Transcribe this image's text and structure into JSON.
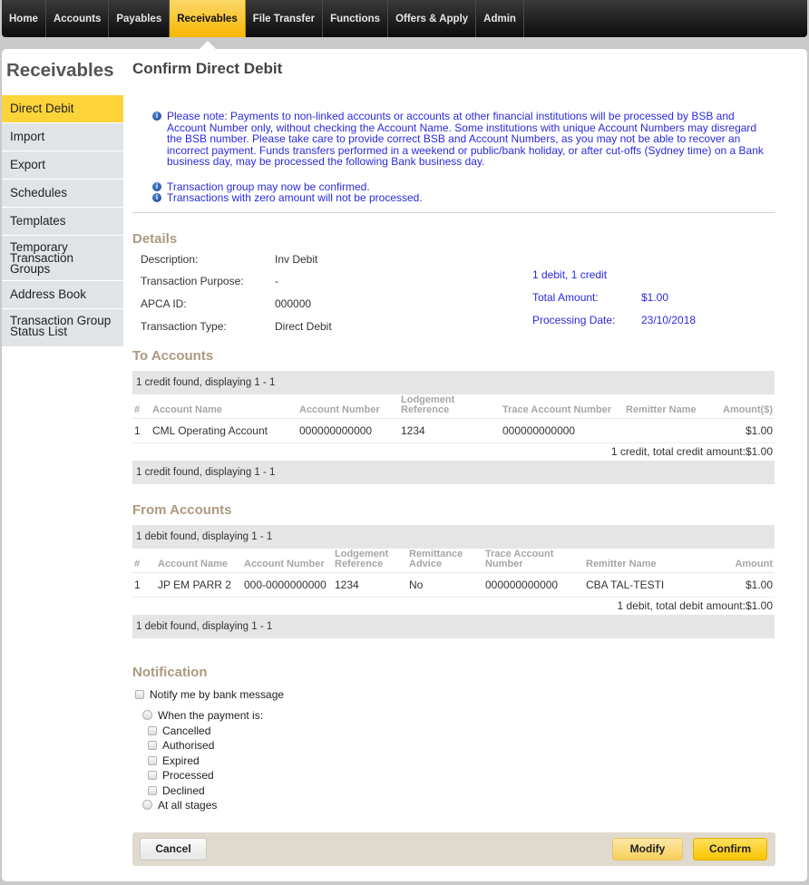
{
  "topnav": {
    "tabs": [
      {
        "label": "Home"
      },
      {
        "label": "Accounts"
      },
      {
        "label": "Payables"
      },
      {
        "label": "Receivables",
        "active": true
      },
      {
        "label": "File Transfer"
      },
      {
        "label": "Functions"
      },
      {
        "label": "Offers & Apply"
      },
      {
        "label": "Admin"
      }
    ]
  },
  "sidebar": {
    "title": "Receivables",
    "items": [
      {
        "label": "Direct Debit",
        "active": true
      },
      {
        "label": "Import"
      },
      {
        "label": "Export"
      },
      {
        "label": "Schedules"
      },
      {
        "label": "Templates"
      },
      {
        "label": "Temporary Transaction Groups"
      },
      {
        "label": "Address Book"
      },
      {
        "label": "Transaction Group Status List"
      }
    ]
  },
  "page": {
    "title": "Confirm Direct Debit",
    "notes": [
      "Please note: Payments to non-linked accounts or accounts at other financial institutions will be processed by BSB and Account Number only, without checking the Account Name. Some institutions with unique Account Numbers may disregard the BSB number. Please take care to provide correct BSB and Account Numbers, as you may not be able to recover an incorrect payment. Funds transfers performed in a weekend or public/bank holiday, or after cut-offs (Sydney time) on a Bank business day, may be processed the following Bank business day.",
      "Transaction group may now be confirmed.",
      "Transactions with zero amount will not be processed."
    ]
  },
  "details": {
    "title": "Details",
    "rows": [
      {
        "label": "Description:",
        "value": "Inv Debit"
      },
      {
        "label": "Transaction Purpose:",
        "value": "-"
      },
      {
        "label": "APCA ID:",
        "value": "000000"
      },
      {
        "label": "Transaction Type:",
        "value": "Direct Debit"
      }
    ],
    "summary": "1 debit, 1 credit",
    "total_amount_label": "Total Amount:",
    "total_amount": "$1.00",
    "processing_date_label": "Processing Date:",
    "processing_date": "23/10/2018"
  },
  "to_accounts": {
    "title": "To Accounts",
    "found_text": "1 credit found, displaying 1 - 1",
    "headers": [
      "#",
      "Account Name",
      "Account Number",
      "Lodgement Reference",
      "Trace Account Number",
      "Remitter Name",
      "Amount($)"
    ],
    "rows": [
      [
        "1",
        "CML Operating Account",
        "000000000000",
        "1234",
        "000000000000",
        "",
        "$1.00"
      ]
    ],
    "total_text": "1 credit, total credit amount:$1.00"
  },
  "from_accounts": {
    "title": "From Accounts",
    "found_text": "1 debit found, displaying 1 - 1",
    "headers": [
      "#",
      "Account Name",
      "Account Number",
      "Lodgement Reference",
      "Remittance Advice",
      "Trace Account Number",
      "Remitter Name",
      "Amount"
    ],
    "rows": [
      [
        "1",
        "JP EM PARR 2",
        "000-0000000000",
        "1234",
        "No",
        "000000000000",
        "CBA TAL-TESTI",
        "$1.00"
      ]
    ],
    "total_text": "1 debit, total debit amount:$1.00"
  },
  "notification": {
    "title": "Notification",
    "notify_label": "Notify me by bank message",
    "when_label": "When the payment is:",
    "stages": [
      "Cancelled",
      "Authorised",
      "Expired",
      "Processed",
      "Declined"
    ],
    "all_label": "At all stages"
  },
  "actions": {
    "cancel": "Cancel",
    "modify": "Modify",
    "confirm": "Confirm"
  }
}
